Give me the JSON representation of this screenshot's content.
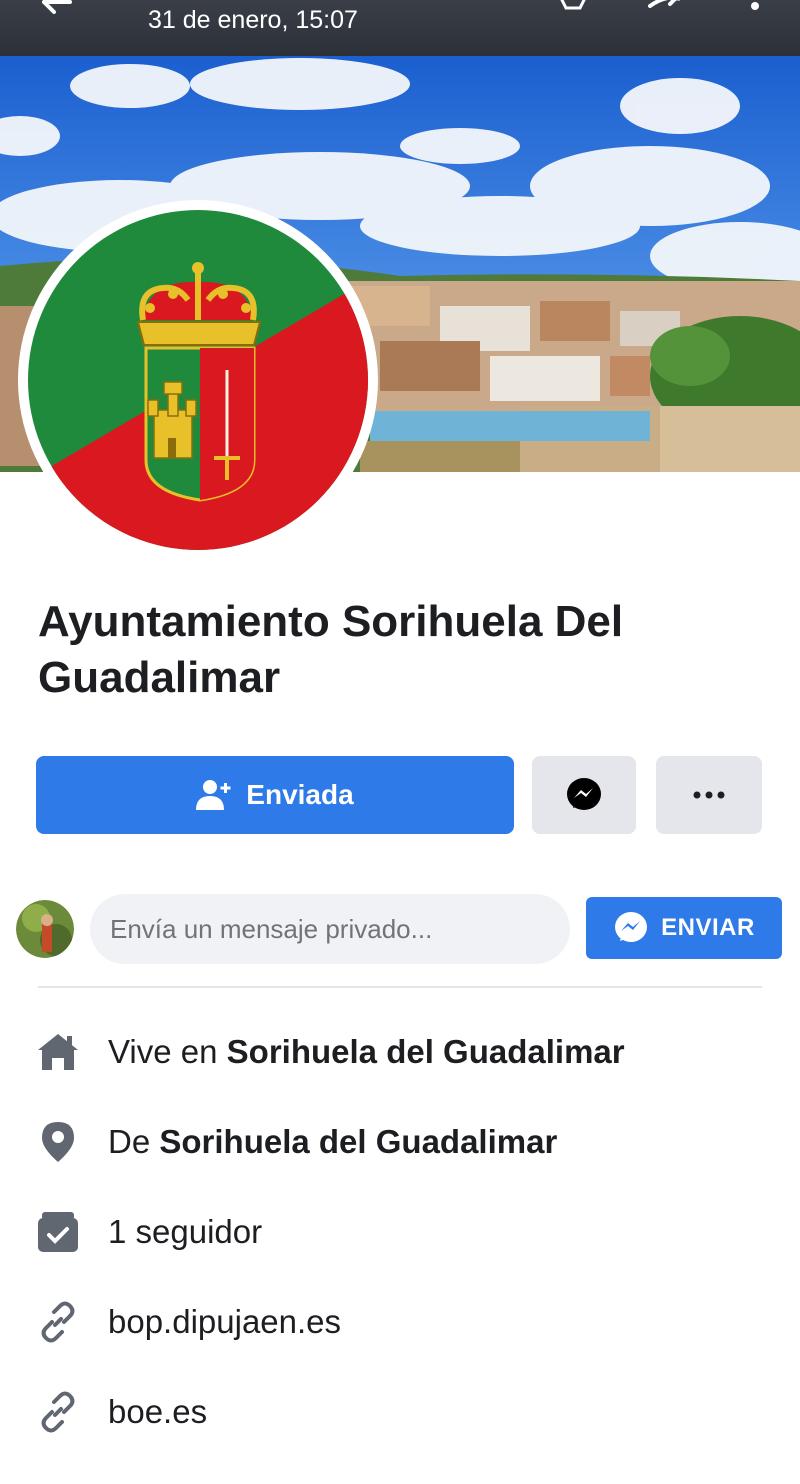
{
  "viewer_bar": {
    "date_label": "31 de enero, 15:07",
    "icons": [
      "back-arrow-icon",
      "star-icon",
      "share-icon",
      "more-vertical-icon"
    ]
  },
  "page": {
    "name": "Ayuntamiento Sorihuela Del Guadalimar"
  },
  "actions": {
    "primary_label": "Enviada",
    "messenger_icon": "messenger-icon",
    "more_icon": "more-horizontal-icon"
  },
  "message": {
    "placeholder": "Envía un mensaje privado...",
    "send_label": "ENVIAR"
  },
  "info": {
    "lives_prefix": "Vive en ",
    "lives_place": "Sorihuela del Guadalimar",
    "from_prefix": "De ",
    "from_place": "Sorihuela del Guadalimar",
    "followers": "1 seguidor",
    "link_1": "bop.dipujaen.es",
    "link_2": "boe.es"
  },
  "colors": {
    "accent_blue": "#2d7ae8",
    "flag_green": "#1f8a3c",
    "flag_red": "#d9191f"
  }
}
